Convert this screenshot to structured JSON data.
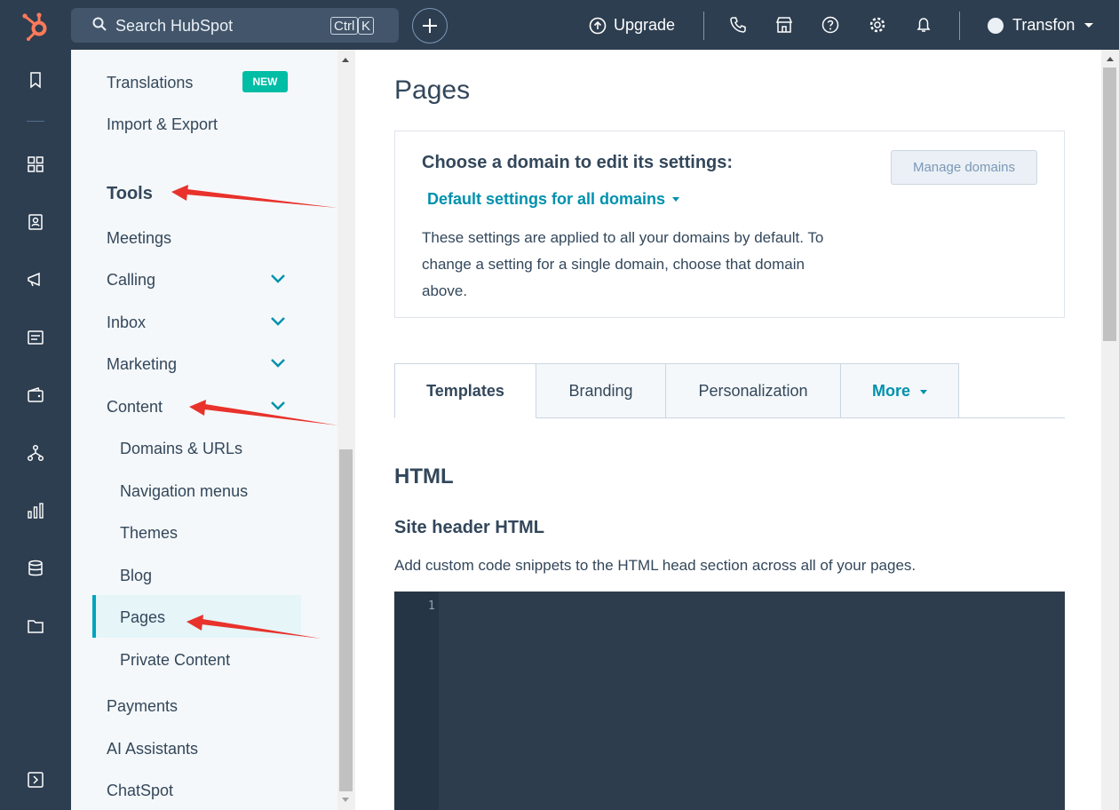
{
  "topbar": {
    "search_placeholder": "Search HubSpot",
    "shortcut_ctrl": "Ctrl",
    "shortcut_key": "K",
    "upgrade_label": "Upgrade",
    "account_name": "Transfon"
  },
  "sidebar": {
    "translations": "Translations",
    "new_badge": "NEW",
    "import_export": "Import & Export",
    "tools_heading": "Tools",
    "meetings": "Meetings",
    "calling": "Calling",
    "inbox": "Inbox",
    "marketing": "Marketing",
    "content": "Content",
    "content_children": [
      "Domains & URLs",
      "Navigation menus",
      "Themes",
      "Blog",
      "Pages",
      "Private Content"
    ],
    "payments": "Payments",
    "ai_assistants": "AI Assistants",
    "chatspot": "ChatSpot",
    "active_item": "Pages"
  },
  "main": {
    "title": "Pages",
    "domain_card": {
      "title": "Choose a domain to edit its settings:",
      "selected_domain": "Default settings for all domains",
      "description": "These settings are applied to all your domains by default. To change a setting for a single domain, choose that domain above.",
      "manage_button": "Manage domains"
    },
    "tabs": [
      "Templates",
      "Branding",
      "Personalization",
      "More"
    ],
    "active_tab": "Templates",
    "section_heading": "HTML",
    "subsection_heading": "Site header HTML",
    "help_text": "Add custom code snippets to the HTML head section across all of your pages.",
    "editor_line_number": "1"
  },
  "colors": {
    "nav_bg": "#2d3e50",
    "accent": "#0091ae",
    "badge": "#00bda5",
    "annotation_arrow": "#e8322b"
  }
}
